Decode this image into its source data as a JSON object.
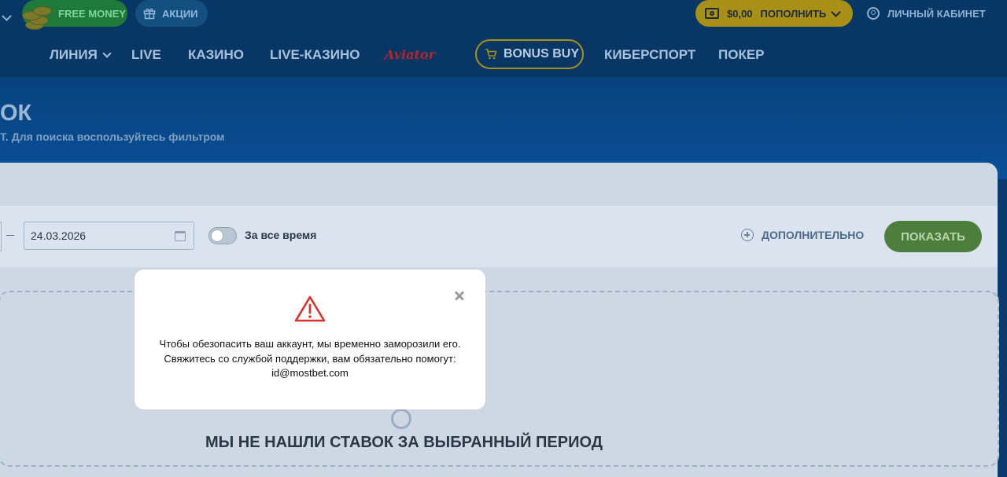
{
  "header": {
    "free_money": "FREE MONEY",
    "promotions": "АКЦИИ",
    "balance": "$0,00",
    "deposit": "ПОПОЛНИТЬ",
    "account": "ЛИЧНЫЙ КАБИНЕТ"
  },
  "nav": {
    "items": [
      "ЛИНИЯ",
      "LIVE",
      "КАЗИНО",
      "LIVE-КАЗИНО",
      "Aviator",
      "BONUS BUY",
      "КИБЕРСПОРТ",
      "ПОКЕР"
    ]
  },
  "page": {
    "title": "ОК",
    "subtitle": "Т. Для поиска воспользуйтесь фильтром"
  },
  "filter": {
    "date_to": "24.03.2026",
    "all_time_label": "За все время",
    "more_label": "ДОПОЛНИТЕЛЬНО",
    "show_button": "ПОКАЗАТЬ"
  },
  "empty_state": {
    "title": "МЫ НЕ НАШЛИ СТАВОК ЗА ВЫБРАННЫЙ ПЕРИОД"
  },
  "modal": {
    "message": "Чтобы обезопасить ваш аккаунт, мы временно заморозили его. Свяжитесь со службой поддержки, вам обязательно помогут: id@mostbet.com"
  },
  "colors": {
    "modal_warning": "#d9342b",
    "show_button": "#4d7e3c",
    "deposit_button": "#a88f16"
  }
}
